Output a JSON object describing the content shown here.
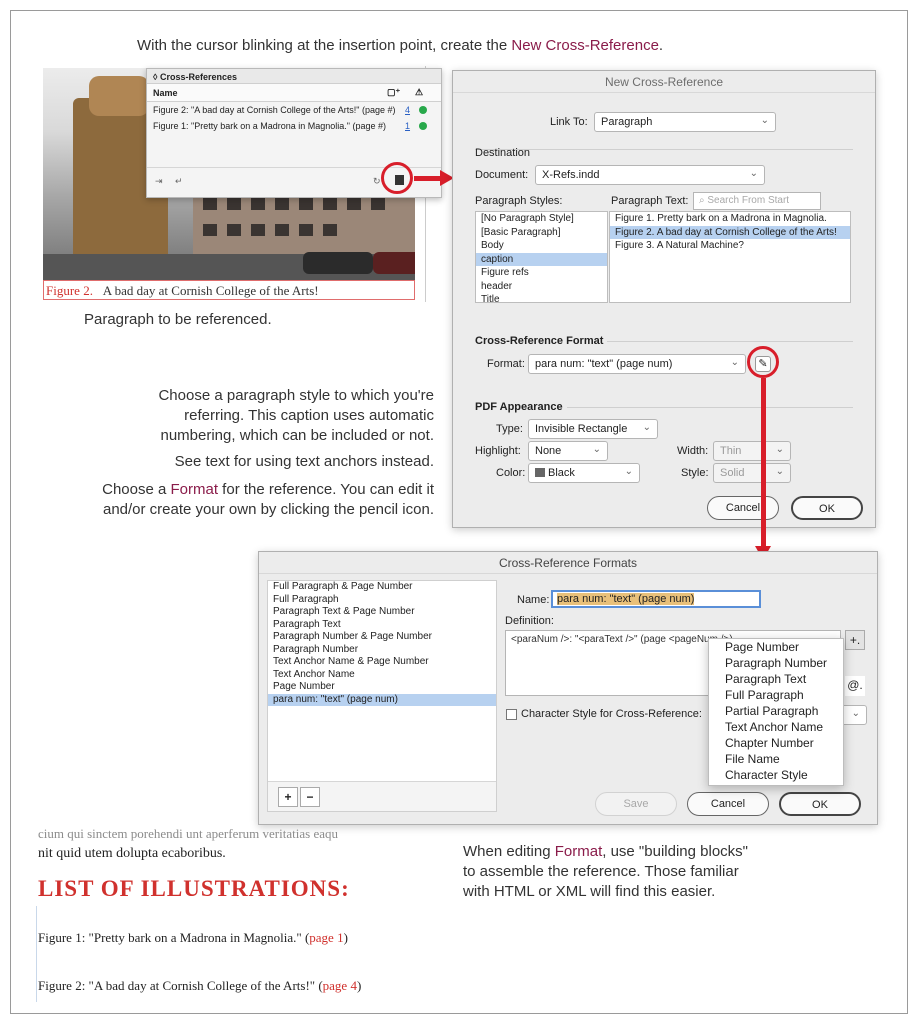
{
  "intro_text": {
    "before": "With the cursor blinking at the insertion point, create the ",
    "accent": "New Cross-Reference",
    "after": "."
  },
  "photo_caption": {
    "label": "Figure 2.",
    "text": "A bad day at Cornish College of the Arts!"
  },
  "caption_note": "Paragraph to be referenced.",
  "panel": {
    "title": "Cross-References",
    "column_name": "Name",
    "rows": [
      {
        "text": "Figure 2: \"A bad day at Cornish College of the Arts!\" (page #)",
        "page": "4"
      },
      {
        "text": "Figure 1: \"Pretty bark on a Madrona in Magnolia.\" (page #)",
        "page": "1"
      }
    ]
  },
  "annotations": {
    "style_choice": [
      "Choose a paragraph style to which you're",
      "referring. This caption uses automatic",
      "numbering, which can be included or not."
    ],
    "anchors": "See text for using text anchors instead.",
    "format_line1_before": "Choose a ",
    "format_accent": "Format",
    "format_line1_after": " for the reference. You can edit it",
    "format_line2": "and/or create your own by clicking the pencil icon."
  },
  "new_xref_dialog": {
    "title": "New Cross-Reference",
    "link_to_label": "Link To:",
    "link_to_value": "Paragraph",
    "destination_label": "Destination",
    "document_label": "Document:",
    "document_value": "X-Refs.indd",
    "para_styles_label": "Paragraph Styles:",
    "para_text_label": "Paragraph Text:",
    "search_placeholder": "Search From Start",
    "styles": [
      "[No Paragraph Style]",
      "[Basic Paragraph]",
      "Body",
      "caption",
      "Figure refs",
      "header",
      "Title"
    ],
    "texts": [
      "Figure 1. Pretty bark on a Madrona in Magnolia.",
      "Figure 2. A bad day at Cornish College of the Arts!",
      "Figure 3. A Natural Machine?"
    ],
    "format_section": "Cross-Reference Format",
    "format_label": "Format:",
    "format_value": "para num: \"text\" (page num)",
    "pdf_section": "PDF Appearance",
    "type_label": "Type:",
    "type_value": "Invisible Rectangle",
    "highlight_label": "Highlight:",
    "highlight_value": "None",
    "width_label": "Width:",
    "width_value": "Thin",
    "color_label": "Color:",
    "color_value": "Black",
    "style_label": "Style:",
    "style_value": "Solid",
    "cancel": "Cancel",
    "ok": "OK"
  },
  "formats_dialog": {
    "title": "Cross-Reference Formats",
    "formats": [
      "Full Paragraph & Page Number",
      "Full Paragraph",
      "Paragraph Text & Page Number",
      "Paragraph Text",
      "Paragraph Number & Page Number",
      "Paragraph Number",
      "Text Anchor Name & Page Number",
      "Text Anchor Name",
      "Page Number",
      "para num: \"text\" (page num)"
    ],
    "name_label": "Name:",
    "name_value": "para num: \"text\" (page num)",
    "definition_label": "Definition:",
    "definition_value": "<paraNum />: \"<paraText />\" (page <pageNum />)",
    "char_style_label": "Character Style for Cross-Reference:",
    "blocks": [
      "Page Number",
      "Paragraph Number",
      "Paragraph Text",
      "Full Paragraph",
      "Partial Paragraph",
      "Text Anchor Name",
      "Chapter Number",
      "File Name",
      "Character Style"
    ],
    "save": "Save",
    "cancel": "Cancel",
    "ok": "OK"
  },
  "format_note": {
    "line1_before": "When editing ",
    "accent": "Format",
    "line1_after": ", use \"building blocks\"",
    "line2": "to assemble the reference. Those familiar",
    "line3": "with HTML or XML will find this easier."
  },
  "document": {
    "faded": "cium qui sinctem porehendi unt aperferum veritatias eaqu",
    "line": "nit quid utem dolupta ecaboribus.",
    "heading": "LIST OF ILLUSTRATIONS:",
    "entries": [
      {
        "text": "Figure 1: \"Pretty bark on a Madrona in Magnolia.\" (",
        "page": "page 1",
        "close": ")"
      },
      {
        "text": "Figure 2: \"A bad day at Cornish College of the Arts!\" (",
        "page": "page 4",
        "close": ")"
      }
    ]
  },
  "colors": {
    "accent": "#8a1c4a",
    "red": "#d81e2a",
    "selection": "#b7d1f0"
  }
}
